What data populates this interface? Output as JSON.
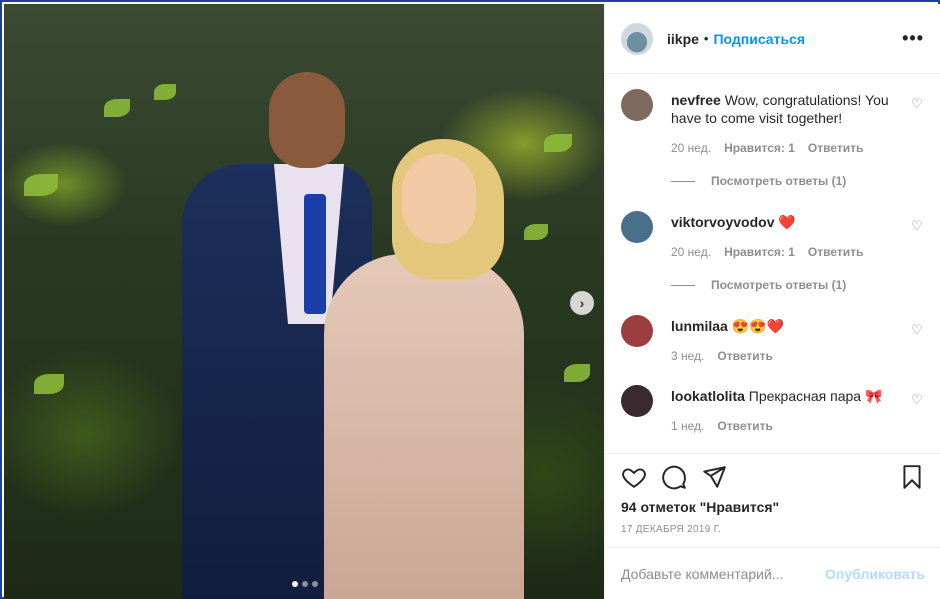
{
  "post": {
    "author": "iikpe",
    "follow_label": "Подписаться",
    "separator": "•",
    "more_label": "•••"
  },
  "comments": [
    {
      "username": "nevfree",
      "text": "Wow, congratulations! You have to come visit together!",
      "age": "20 нед.",
      "likes": "Нравится: 1",
      "reply": "Ответить",
      "view_replies": "Посмотреть ответы (1)",
      "avatar_color": "#7d6a5c"
    },
    {
      "username": "viktorvoyvodov",
      "text": "❤️",
      "age": "20 нед.",
      "likes": "Нравится: 1",
      "reply": "Ответить",
      "view_replies": "Посмотреть ответы (1)",
      "avatar_color": "#4a6f8a"
    },
    {
      "username": "lunmilaa",
      "text": "😍😍❤️",
      "age": "3 нед.",
      "reply": "Ответить",
      "avatar_color": "#9b3e3e"
    },
    {
      "username": "lookatlolita",
      "text": "Прекрасная пара 🎀",
      "age": "1 нед.",
      "reply": "Ответить",
      "avatar_color": "#3a2a30"
    }
  ],
  "actions": {
    "likes_text": "94 отметок \"Нравится\"",
    "date": "17 ДЕКАБРЯ 2019 Г."
  },
  "add_comment": {
    "placeholder": "Добавьте комментарий...",
    "post_label": "Опубликовать"
  },
  "carousel": {
    "next_glyph": "›",
    "slide_count": 3,
    "active_slide": 1
  },
  "colors": {
    "link_blue": "#0095f6",
    "post_disabled": "#b3dbff",
    "secondary_text": "#8e8e8e",
    "heart_red": "#ed4956"
  }
}
